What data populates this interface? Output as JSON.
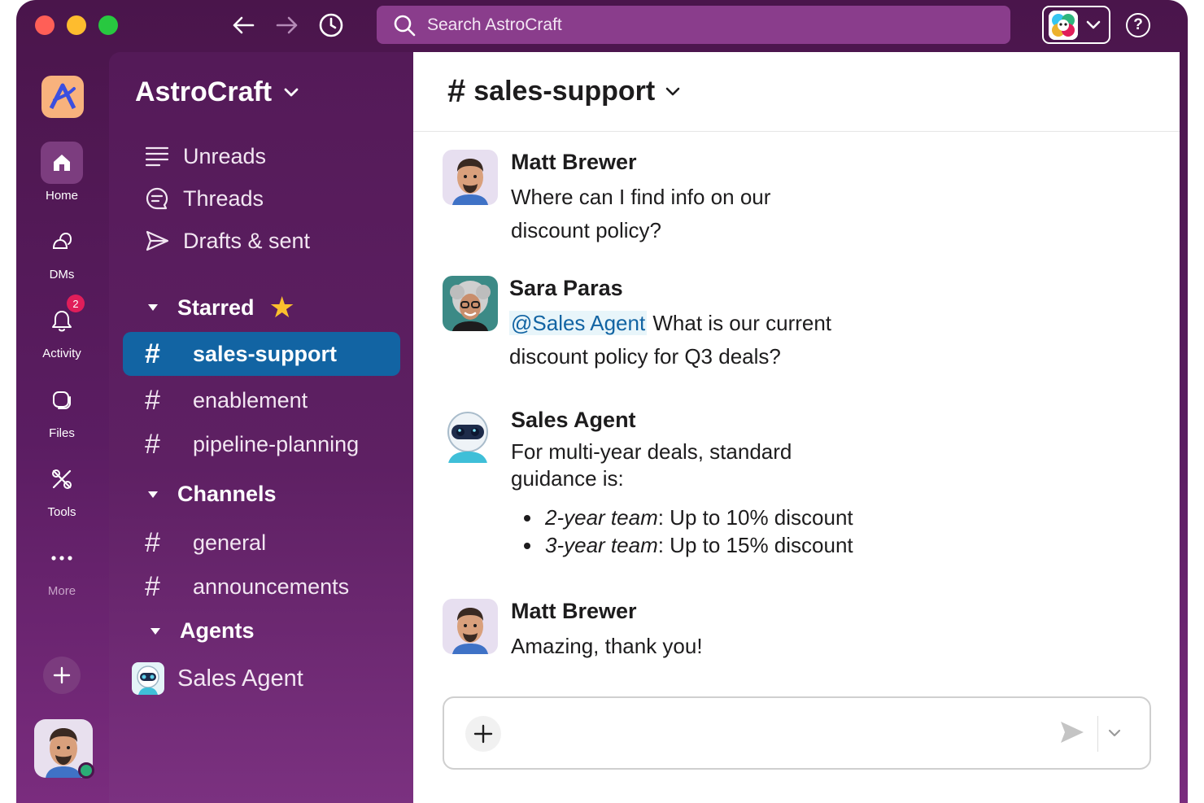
{
  "titlebar": {
    "search_placeholder": "Search AstroCraft"
  },
  "rail": {
    "items": [
      {
        "label": "Home",
        "icon": "home-icon"
      },
      {
        "label": "DMs",
        "icon": "dm-icon"
      },
      {
        "label": "Activity",
        "icon": "bell-icon",
        "badge": "2"
      },
      {
        "label": "Files",
        "icon": "files-icon"
      },
      {
        "label": "Tools",
        "icon": "tools-icon"
      },
      {
        "label": "More",
        "icon": "more-icon"
      }
    ]
  },
  "sidebar": {
    "workspace_name": "AstroCraft",
    "nav": [
      {
        "label": "Unreads",
        "icon": "unreads-icon"
      },
      {
        "label": "Threads",
        "icon": "threads-icon"
      },
      {
        "label": "Drafts & sent",
        "icon": "send-icon"
      }
    ],
    "sections": {
      "starred": {
        "title": "Starred",
        "channels": [
          "sales-support",
          "enablement",
          "pipeline-planning"
        ],
        "active": "sales-support"
      },
      "channels": {
        "title": "Channels",
        "channels": [
          "general",
          "announcements"
        ]
      },
      "agents": {
        "title": "Agents",
        "items": [
          "Sales Agent"
        ]
      }
    }
  },
  "channel": {
    "name": "sales-support",
    "hash": "#"
  },
  "messages": [
    {
      "author": "Matt Brewer",
      "lines": [
        "Where can I find info on our",
        "discount policy?"
      ]
    },
    {
      "author": "Sara Paras",
      "mention": "@Sales Agent",
      "text_after_mention": " What is our current",
      "text_line2": "discount policy for Q3 deals?"
    },
    {
      "author": "Sales Agent",
      "lines": [
        "For multi-year deals, standard",
        "guidance is:"
      ],
      "bullets": [
        {
          "term": "2-year team",
          "detail": ": Up to 10% discount"
        },
        {
          "term": "3-year team",
          "detail": ": Up to 15% discount"
        }
      ]
    },
    {
      "author": "Matt Brewer",
      "lines": [
        "Amazing, thank you!"
      ]
    }
  ],
  "colors": {
    "aubergine": "#4a154b",
    "active_blue": "#1264a3",
    "star": "#fbc02d",
    "badge": "#e01e5a",
    "presence": "#2bac76"
  }
}
